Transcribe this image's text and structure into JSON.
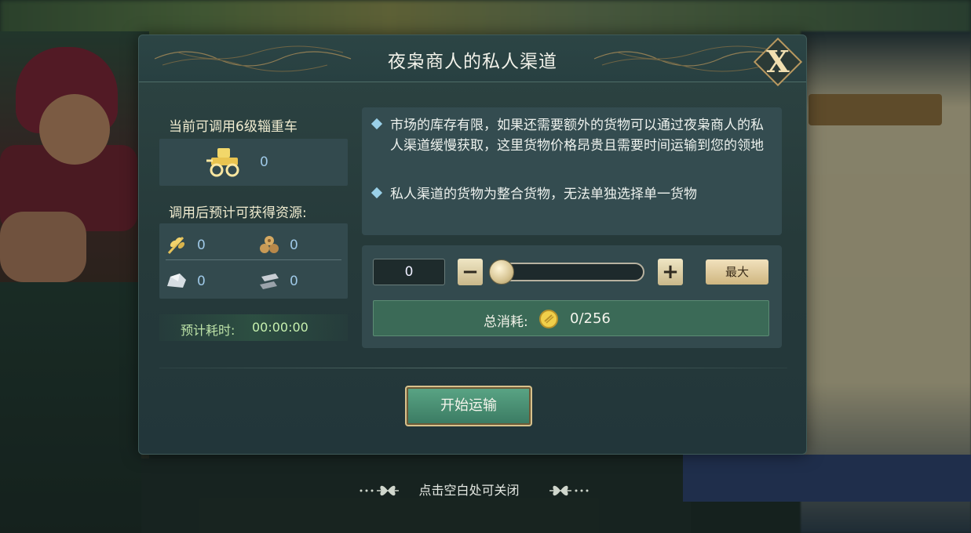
{
  "dialog": {
    "title": "夜枭商人的私人渠道",
    "close_label": "X"
  },
  "left_panel": {
    "available_label": "当前可调用6级辎重车",
    "wagon_icon": "wagon-icon",
    "wagon_count": "0",
    "resources_label": "调用后预计可获得资源:",
    "resources": [
      {
        "icon": "wheat-icon",
        "value": "0"
      },
      {
        "icon": "wood-icon",
        "value": "0"
      },
      {
        "icon": "stone-icon",
        "value": "0"
      },
      {
        "icon": "iron-icon",
        "value": "0"
      }
    ],
    "time_label": "预计耗时:",
    "time_value": "00:00:00"
  },
  "info": {
    "items": [
      "市场的库存有限，如果还需要额外的货物可以通过夜枭商人的私人渠道缓慢获取，这里货物价格昂贵且需要时间运输到您的领地",
      "私人渠道的货物为整合货物，无法单独选择单一货物"
    ]
  },
  "purchase": {
    "quantity": "0",
    "minus_label": "−",
    "plus_label": "+",
    "max_label": "最大",
    "slider_value": 0,
    "total_label": "总消耗:",
    "coin_icon": "gold-coin-icon",
    "total_value": "0/256"
  },
  "start_button": "开始运输",
  "close_hint": "点击空白处可关闭",
  "colors": {
    "panel_bg": "#263a3a",
    "accent_gold": "#d8c28c",
    "button_green": "#3a7a62",
    "time_green": "#c6f0ae"
  }
}
